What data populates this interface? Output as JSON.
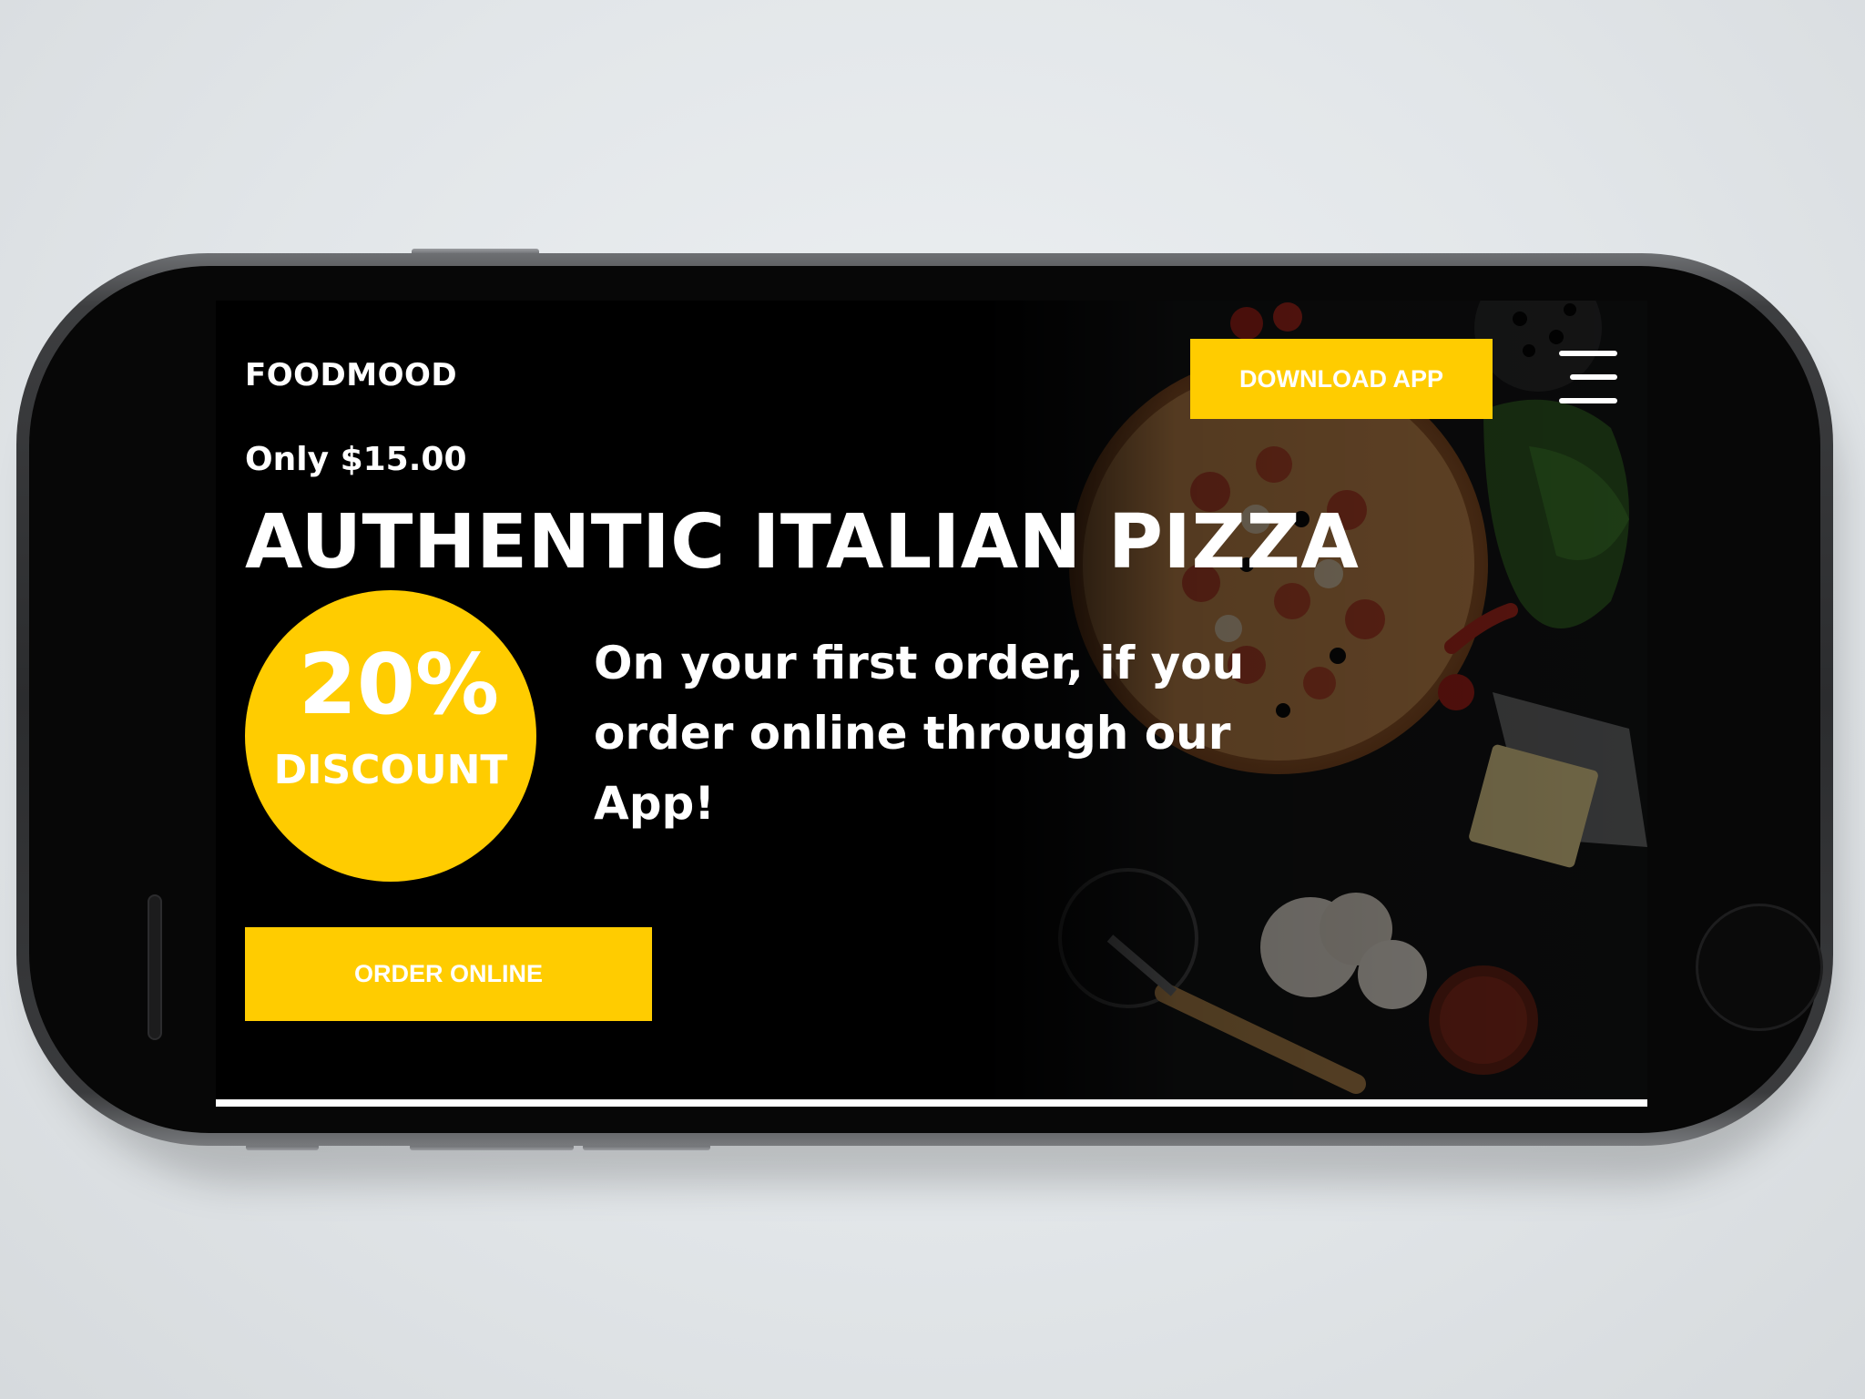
{
  "site": {
    "logo": "FOODMOOD",
    "download_label": "DOWNLOAD APP",
    "menu_icon": "hamburger-menu-icon"
  },
  "hero": {
    "price": "Only $15.00",
    "title": "AUTHENTIC ITALIAN PIZZA",
    "discount_percent": "20%",
    "discount_label": "DISCOUNT",
    "offer_text": "On your first order, if you order online through our App!",
    "order_label": "ORDER ONLINE"
  },
  "colors": {
    "accent": "#ffcc00",
    "background": "#000000",
    "text": "#ffffff"
  }
}
